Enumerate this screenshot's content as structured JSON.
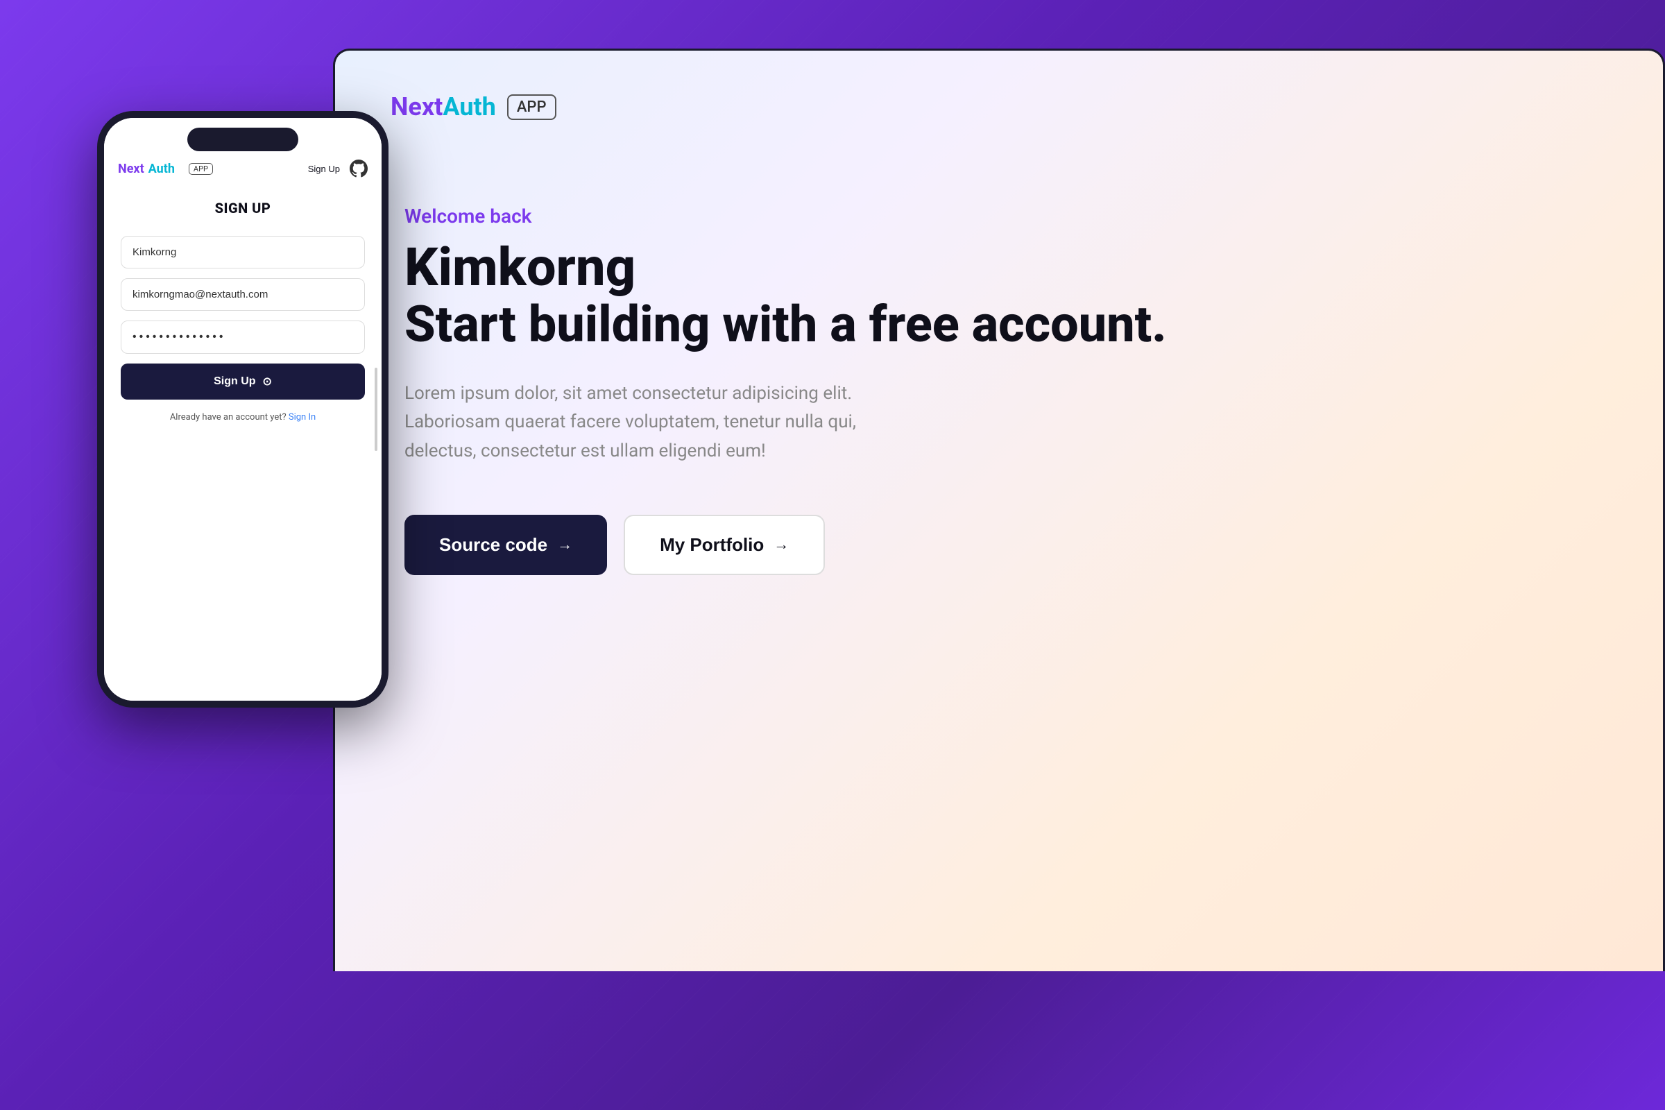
{
  "background": {
    "color": "#6b21d6"
  },
  "desktop": {
    "nav": {
      "logo_next": "Next",
      "logo_auth": "Auth",
      "app_badge": "APP"
    },
    "hero": {
      "welcome": "Welcome back",
      "name": "Kimkorng",
      "subtitle": "Start building with a free account.",
      "description": "Lorem ipsum dolor, sit amet consectetur adipisicing elit. Laboriosam quaerat facere voluptatem, tenetur nulla qui, delectus, consectetur est ullam eligendi eum!",
      "btn_source": "Source code",
      "btn_portfolio": "My Portfolio",
      "arrow": "→"
    }
  },
  "phone": {
    "nav": {
      "logo_next": "Next",
      "logo_auth": "Auth",
      "app_badge": "APP",
      "signup_label": "Sign Up"
    },
    "form": {
      "title": "SIGN UP",
      "name_placeholder": "Kimkorng",
      "email_placeholder": "kimkorngmao@nextauth.com",
      "password_placeholder": "••••••••••••••",
      "submit_label": "Sign Up",
      "signin_prompt": "Already have an account yet?",
      "signin_link": "Sign In"
    }
  }
}
